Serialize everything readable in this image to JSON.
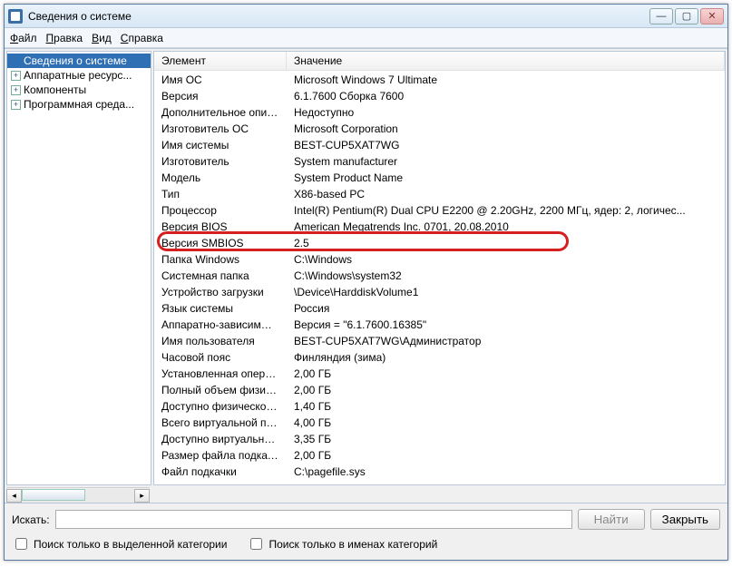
{
  "window": {
    "title": "Сведения о системе"
  },
  "menu": {
    "file": "Файл",
    "edit": "Правка",
    "view": "Вид",
    "help": "Справка"
  },
  "tree": {
    "root": "Сведения о системе",
    "items": [
      "Аппаратные ресурс...",
      "Компоненты",
      "Программная среда..."
    ]
  },
  "columns": {
    "element": "Элемент",
    "value": "Значение"
  },
  "rows": [
    {
      "k": "Имя ОС",
      "v": "Microsoft Windows 7 Ultimate"
    },
    {
      "k": "Версия",
      "v": "6.1.7600 Сборка 7600"
    },
    {
      "k": "Дополнительное описание ОС",
      "v": "Недоступно"
    },
    {
      "k": "Изготовитель ОС",
      "v": "Microsoft Corporation"
    },
    {
      "k": "Имя системы",
      "v": "BEST-CUP5XAT7WG"
    },
    {
      "k": "Изготовитель",
      "v": "System manufacturer"
    },
    {
      "k": "Модель",
      "v": "System Product Name"
    },
    {
      "k": "Тип",
      "v": "X86-based PC"
    },
    {
      "k": "Процессор",
      "v": "Intel(R) Pentium(R) Dual  CPU  E2200   @ 2.20GHz, 2200 МГц, ядер: 2, логичес..."
    },
    {
      "k": "Версия BIOS",
      "v": "American Megatrends Inc. 0701, 20.08.2010"
    },
    {
      "k": "Версия SMBIOS",
      "v": "2.5"
    },
    {
      "k": "Папка Windows",
      "v": "C:\\Windows"
    },
    {
      "k": "Системная папка",
      "v": "C:\\Windows\\system32"
    },
    {
      "k": "Устройство загрузки",
      "v": "\\Device\\HarddiskVolume1"
    },
    {
      "k": "Язык системы",
      "v": "Россия"
    },
    {
      "k": "Аппаратно-зависимый уровен...",
      "v": "Версия = \"6.1.7600.16385\""
    },
    {
      "k": "Имя пользователя",
      "v": "BEST-CUP5XAT7WG\\Администратор"
    },
    {
      "k": "Часовой пояс",
      "v": "Финляндия (зима)"
    },
    {
      "k": "Установленная оперативная п...",
      "v": "2,00 ГБ"
    },
    {
      "k": "Полный объем физической па...",
      "v": "2,00 ГБ"
    },
    {
      "k": "Доступно физической памяти",
      "v": "1,40 ГБ"
    },
    {
      "k": "Всего виртуальной памяти",
      "v": "4,00 ГБ"
    },
    {
      "k": "Доступно виртуальной памяти",
      "v": "3,35 ГБ"
    },
    {
      "k": "Размер файла подкачки",
      "v": "2,00 ГБ"
    },
    {
      "k": "Файл подкачки",
      "v": "C:\\pagefile.sys"
    }
  ],
  "search": {
    "label": "Искать:",
    "find": "Найти",
    "close": "Закрыть",
    "cb1": "Поиск только в выделенной категории",
    "cb2": "Поиск только в именах категорий"
  }
}
